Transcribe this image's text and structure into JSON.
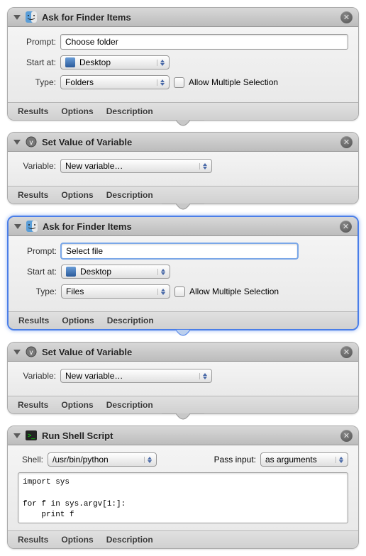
{
  "common": {
    "results": "Results",
    "options": "Options",
    "description": "Description"
  },
  "action1": {
    "title": "Ask for Finder Items",
    "prompt_label": "Prompt:",
    "prompt_value": "Choose folder",
    "start_label": "Start at:",
    "start_value": "Desktop",
    "type_label": "Type:",
    "type_value": "Folders",
    "allow_multi": "Allow Multiple Selection"
  },
  "action2": {
    "title": "Set Value of Variable",
    "var_label": "Variable:",
    "var_value": "New variable…"
  },
  "action3": {
    "title": "Ask for Finder Items",
    "prompt_label": "Prompt:",
    "prompt_value": "Select file",
    "start_label": "Start at:",
    "start_value": "Desktop",
    "type_label": "Type:",
    "type_value": "Files",
    "allow_multi": "Allow Multiple Selection"
  },
  "action4": {
    "title": "Set Value of Variable",
    "var_label": "Variable:",
    "var_value": "New variable…"
  },
  "action5": {
    "title": "Run Shell Script",
    "shell_label": "Shell:",
    "shell_value": "/usr/bin/python",
    "pass_label": "Pass input:",
    "pass_value": "as arguments",
    "script": "import sys\n\nfor f in sys.argv[1:]:\n    print f"
  }
}
